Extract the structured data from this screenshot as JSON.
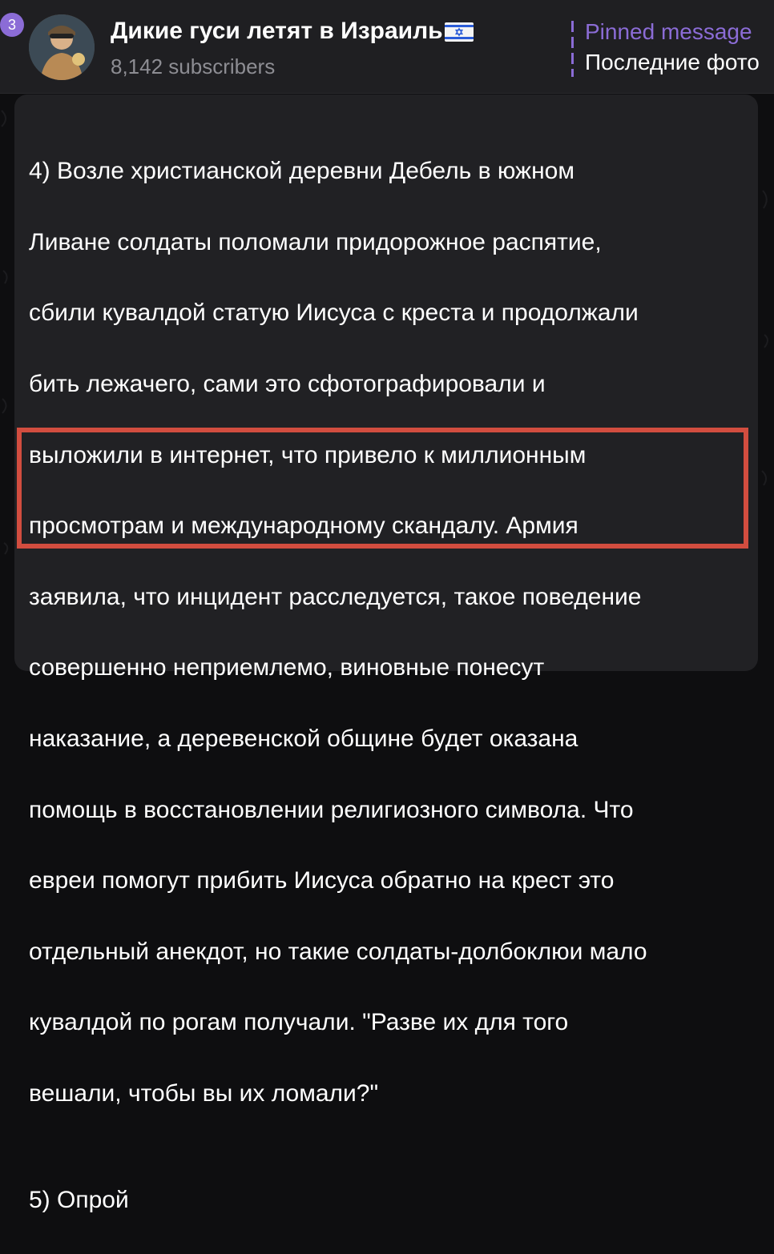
{
  "header": {
    "unread_count": "3",
    "channel_title": "Дикие гуси летят в Израиль",
    "flag_icon": "israel-flag-icon",
    "subscribers": "8,142 subscribers",
    "pinned_label": "Pinned message",
    "pinned_preview": "Последние фото"
  },
  "message": {
    "lines": [
      "4) Возле христианской деревни Дебель в южном",
      "Ливане солдаты поломали придорожное распятие,",
      "сбили кувалдой статую Иисуса с креста и продолжали",
      "бить лежачего, сами это сфотографировали и",
      "выложили в интернет, что привело к миллионным",
      "просмотрам и международному скандалу. Армия",
      "заявила, что инцидент расследуется, такое поведение",
      "совершенно неприемлемо, виновные понесут",
      "наказание, а деревенской общине будет оказана",
      "помощь в восстановлении религиозного символа. Что",
      "евреи помогут прибить Иисуса обратно на крест это",
      "отдельный анекдот, но такие солдаты-долбоклюи мало",
      "кувалдой по рогам получали. \"Разве их для того",
      "вешали, чтобы вы их ломали?\"",
      "",
      "5) Опрой"
    ]
  },
  "colors": {
    "accent": "#8b6cd6",
    "highlight_border": "#d24d3f",
    "bubble": "#212124",
    "header_bg": "#1f1f22"
  }
}
